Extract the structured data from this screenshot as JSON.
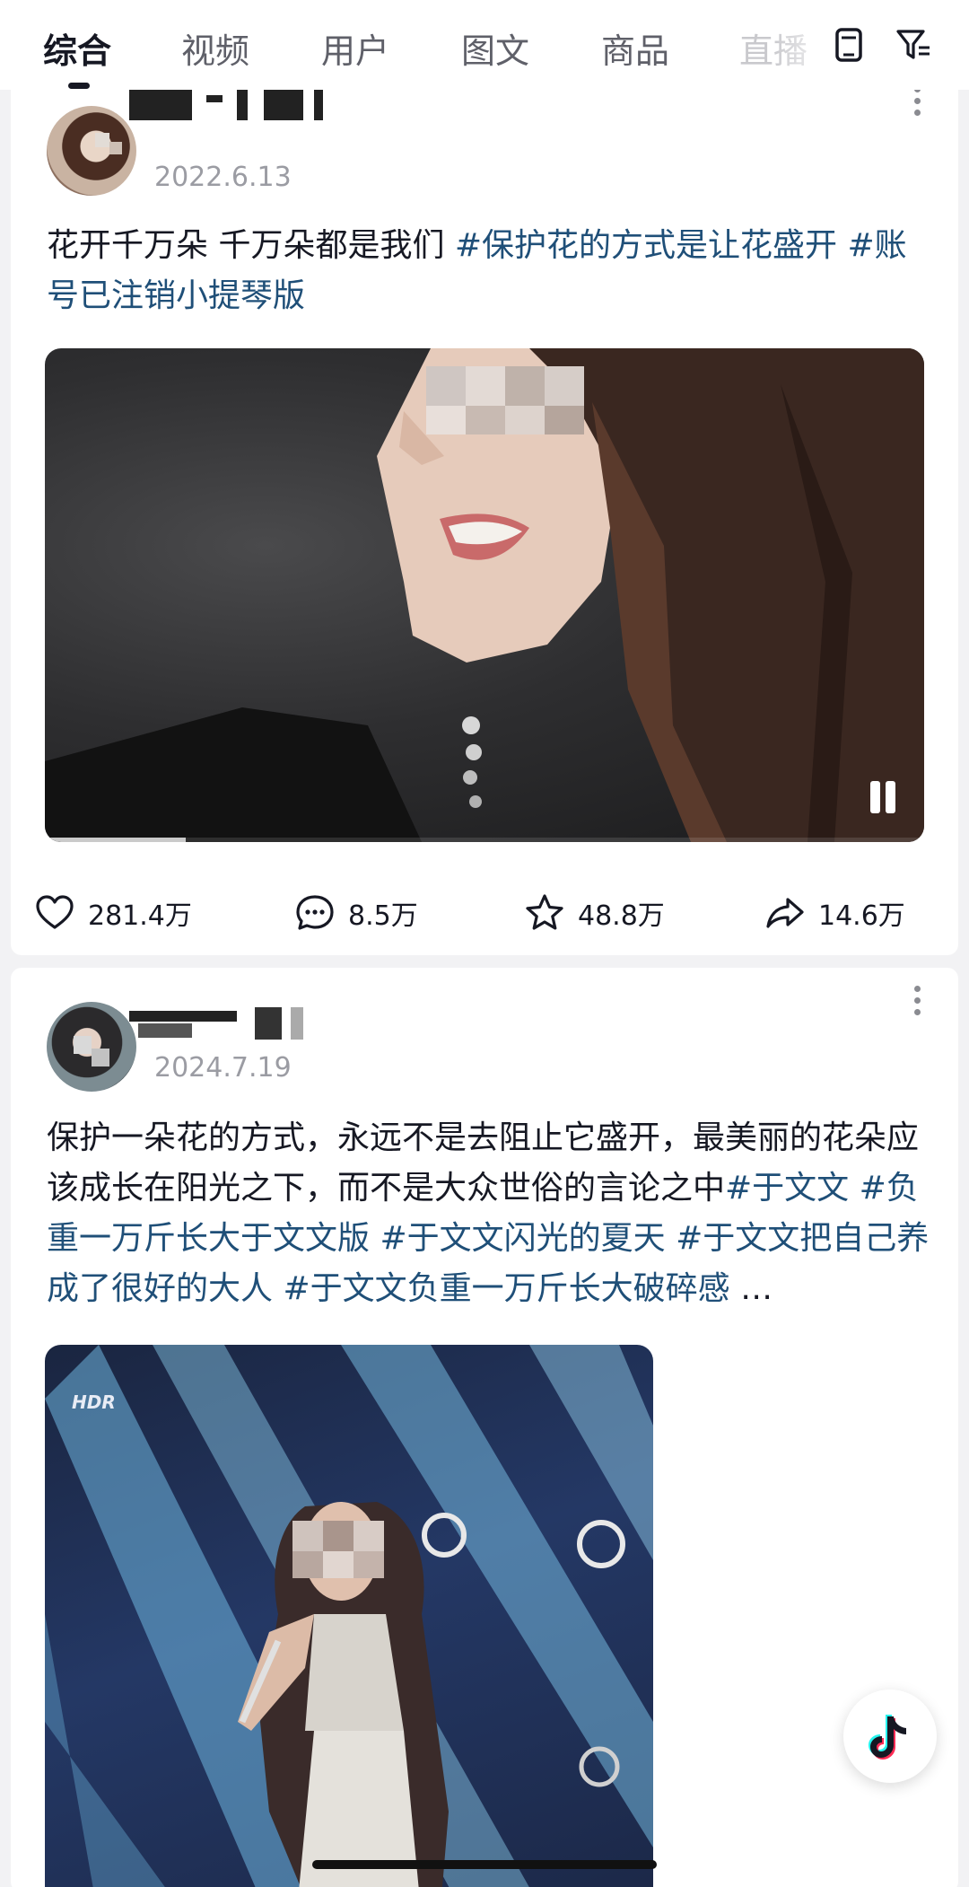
{
  "tabs": [
    {
      "label": "综合",
      "active": true
    },
    {
      "label": "视频",
      "active": false
    },
    {
      "label": "用户",
      "active": false
    },
    {
      "label": "图文",
      "active": false
    },
    {
      "label": "商品",
      "active": false
    },
    {
      "label": "直播",
      "active": false
    }
  ],
  "posts": [
    {
      "date": "2022.6.13",
      "caption_text": "花开千万朵 千万朵都是我们 ",
      "hashtags": [
        "#保护花的方式是让花盛开",
        "#账号已注销小提琴版"
      ],
      "stats": {
        "likes": "281.4万",
        "comments": "8.5万",
        "favorites": "48.8万",
        "shares": "14.6万"
      },
      "video_progress": 0.16
    },
    {
      "date": "2024.7.19",
      "caption_text": "保护一朵花的方式，永远不是去阻止它盛开，最美丽的花朵应该成长在阳光之下，而不是大众世俗的言论之中",
      "hashtags": [
        "#于文文",
        "#负重一万斤长大于文文版",
        "#于文文闪光的夏天",
        "#于文文把自己养成了很好的大人",
        "#于文文负重一万斤长大破碎感"
      ],
      "ellipsis": "…",
      "media_badge": "HDR"
    }
  ],
  "colors": {
    "hashtag": "#1f4f78",
    "text": "#161823",
    "muted": "#9b9ca3"
  },
  "icons": [
    "tablet-icon",
    "filter-icon",
    "more-icon",
    "heart-icon",
    "comment-icon",
    "star-icon",
    "share-icon",
    "pause-icon",
    "tiktok-logo-icon"
  ]
}
